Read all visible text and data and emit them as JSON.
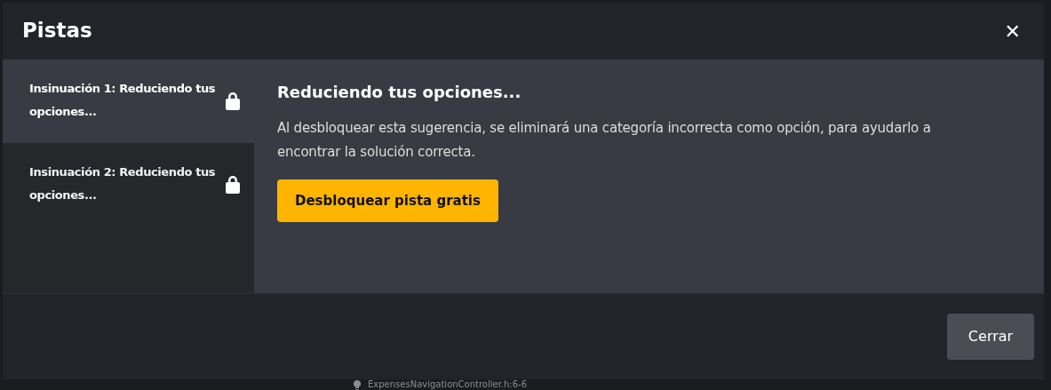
{
  "dialog": {
    "title": "Pistas",
    "close_symbol": "✕"
  },
  "hints": [
    {
      "label": "Insinuación 1: Reduciendo tus opciones...",
      "locked": true,
      "selected": true
    },
    {
      "label": "Insinuación 2: Reduciendo tus opciones...",
      "locked": true,
      "selected": false
    }
  ],
  "content": {
    "heading": "Reduciendo tus opciones...",
    "description": "Al desbloquear esta sugerencia, se eliminará una categoría incorrecta como opción, para ayudarlo a encontrar la solución correcta.",
    "unlock_button": "Desbloquear pista gratis"
  },
  "footer": {
    "close_button": "Cerrar"
  },
  "background": {
    "file_reference": "ExpensesNavigationController.h:6-6"
  }
}
